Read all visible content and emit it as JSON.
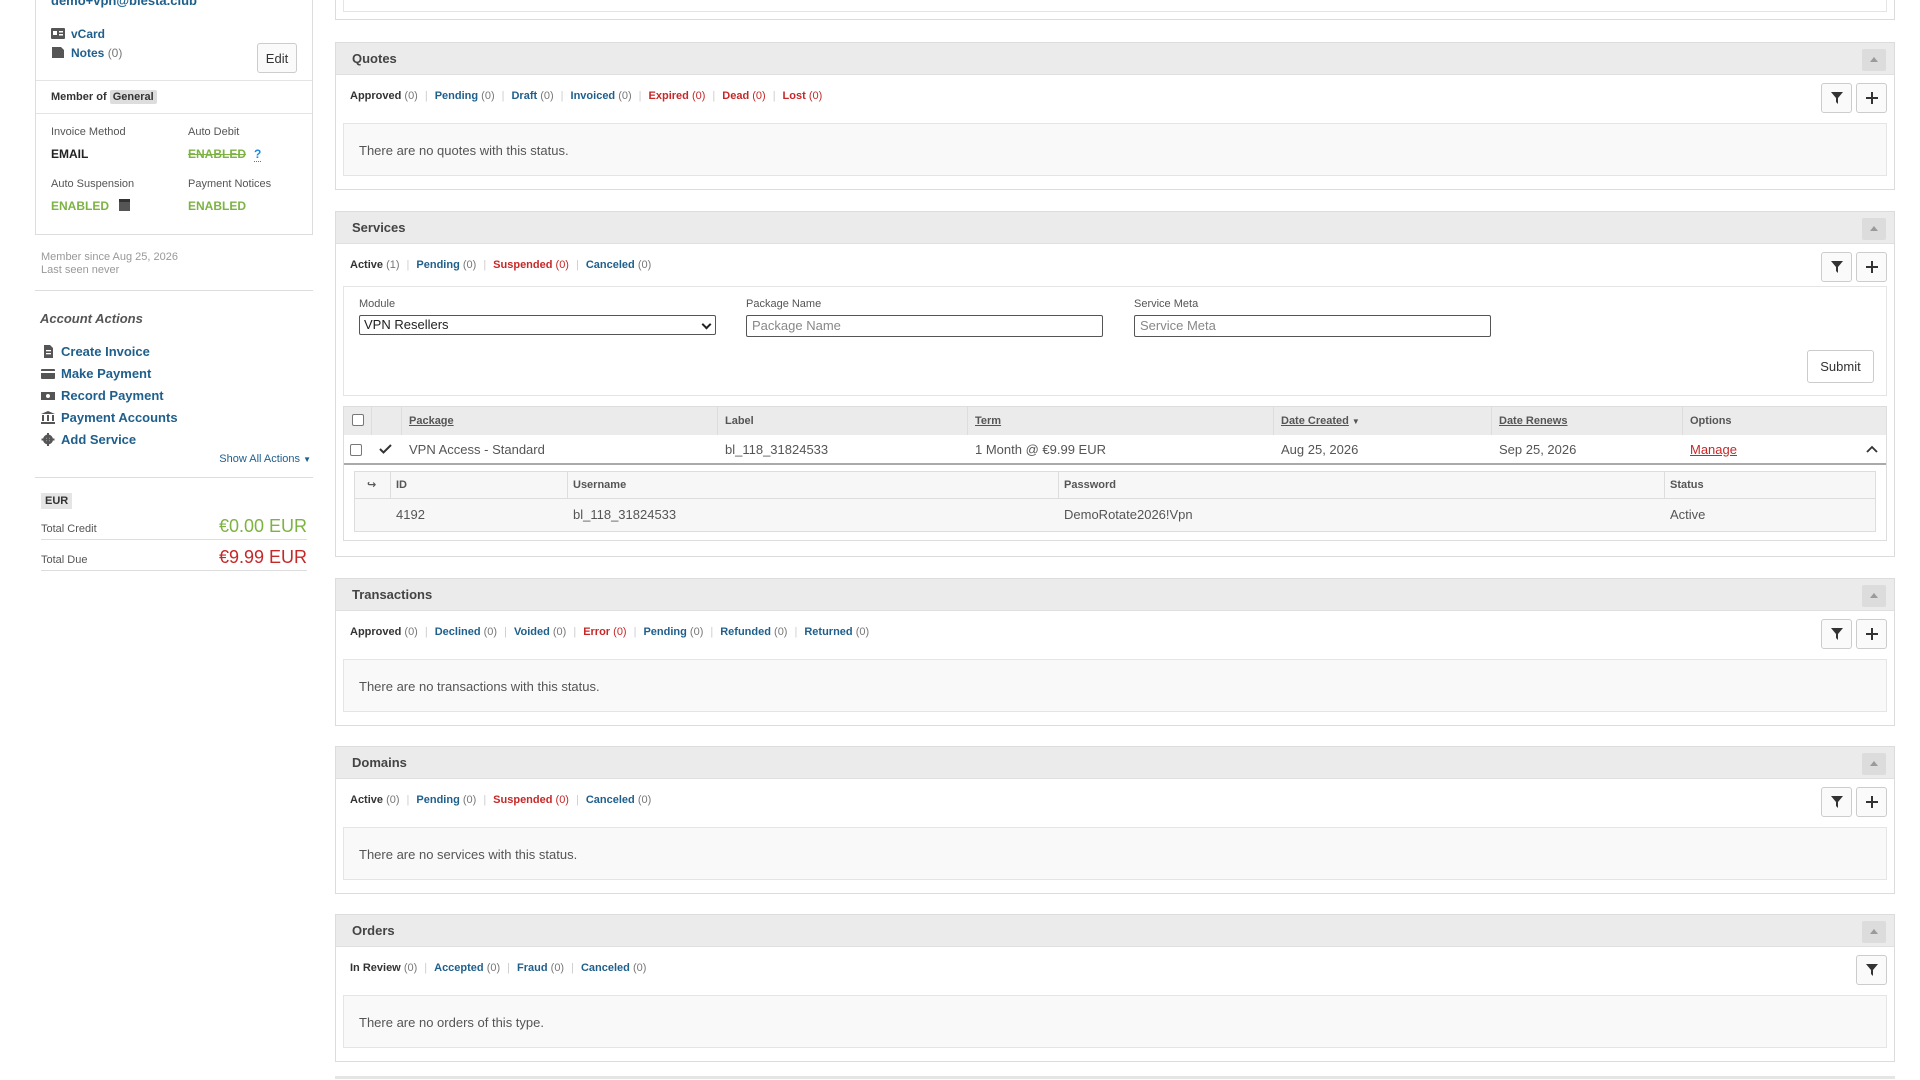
{
  "client": {
    "email": "demo+vpn@blesta.club",
    "vcard_label": "vCard",
    "notes_label": "Notes",
    "notes_count": "(0)",
    "edit_label": "Edit",
    "member_of_label": "Member of",
    "group": "General",
    "settings": {
      "invoice_method_label": "Invoice Method",
      "invoice_method": "EMAIL",
      "auto_debit_label": "Auto Debit",
      "auto_debit": "ENABLED",
      "auto_debit_help": "?",
      "auto_suspension_label": "Auto Suspension",
      "auto_suspension": "ENABLED",
      "payment_notices_label": "Payment Notices",
      "payment_notices": "ENABLED"
    },
    "member_since": "Member since Aug 25, 2026",
    "last_seen": "Last seen never"
  },
  "account_actions": {
    "heading": "Account Actions",
    "items": [
      {
        "label": "Create Invoice",
        "icon": "file-invoice-icon"
      },
      {
        "label": "Make Payment",
        "icon": "credit-card-icon"
      },
      {
        "label": "Record Payment",
        "icon": "money-icon"
      },
      {
        "label": "Payment Accounts",
        "icon": "bank-icon"
      },
      {
        "label": "Add Service",
        "icon": "gear-icon"
      }
    ],
    "show_all": "Show All Actions"
  },
  "balance": {
    "currency": "EUR",
    "total_credit_label": "Total Credit",
    "total_credit": "€0.00 EUR",
    "total_due_label": "Total Due",
    "total_due": "€9.99 EUR"
  },
  "quotes": {
    "title": "Quotes",
    "tabs": [
      {
        "label": "Approved",
        "count": "(0)",
        "style": "default"
      },
      {
        "label": "Pending",
        "count": "(0)",
        "style": "blue"
      },
      {
        "label": "Draft",
        "count": "(0)",
        "style": "blue"
      },
      {
        "label": "Invoiced",
        "count": "(0)",
        "style": "blue"
      },
      {
        "label": "Expired",
        "count": "(0)",
        "style": "red"
      },
      {
        "label": "Dead",
        "count": "(0)",
        "style": "red"
      },
      {
        "label": "Lost",
        "count": "(0)",
        "style": "red"
      }
    ],
    "empty": "There are no quotes with this status."
  },
  "services": {
    "title": "Services",
    "tabs": [
      {
        "label": "Active",
        "count": "(1)",
        "style": "default"
      },
      {
        "label": "Pending",
        "count": "(0)",
        "style": "blue"
      },
      {
        "label": "Suspended",
        "count": "(0)",
        "style": "red"
      },
      {
        "label": "Canceled",
        "count": "(0)",
        "style": "blue"
      }
    ],
    "filter": {
      "module_label": "Module",
      "module_value": "VPN Resellers",
      "package_label": "Package Name",
      "package_placeholder": "Package Name",
      "meta_label": "Service Meta",
      "meta_placeholder": "Service Meta",
      "submit": "Submit"
    },
    "columns": {
      "package": "Package",
      "label": "Label",
      "term": "Term",
      "date_created": "Date Created",
      "date_renews": "Date Renews",
      "options": "Options"
    },
    "row": {
      "package": "VPN Access - Standard",
      "label": "bl_118_31824533",
      "term": "1 Month @ €9.99 EUR",
      "date_created": "Aug 25, 2026",
      "date_renews": "Sep 25, 2026",
      "manage": "Manage"
    },
    "detail": {
      "columns": {
        "id": "ID",
        "username": "Username",
        "password": "Password",
        "status": "Status"
      },
      "row": {
        "id": "4192",
        "username": "bl_118_31824533",
        "password": "DemoRotate2026!Vpn",
        "status": "Active"
      }
    }
  },
  "transactions": {
    "title": "Transactions",
    "tabs": [
      {
        "label": "Approved",
        "count": "(0)",
        "style": "default"
      },
      {
        "label": "Declined",
        "count": "(0)",
        "style": "blue"
      },
      {
        "label": "Voided",
        "count": "(0)",
        "style": "blue"
      },
      {
        "label": "Error",
        "count": "(0)",
        "style": "red"
      },
      {
        "label": "Pending",
        "count": "(0)",
        "style": "blue"
      },
      {
        "label": "Refunded",
        "count": "(0)",
        "style": "blue"
      },
      {
        "label": "Returned",
        "count": "(0)",
        "style": "blue"
      }
    ],
    "empty": "There are no transactions with this status."
  },
  "domains": {
    "title": "Domains",
    "tabs": [
      {
        "label": "Active",
        "count": "(0)",
        "style": "default"
      },
      {
        "label": "Pending",
        "count": "(0)",
        "style": "blue"
      },
      {
        "label": "Suspended",
        "count": "(0)",
        "style": "red"
      },
      {
        "label": "Canceled",
        "count": "(0)",
        "style": "blue"
      }
    ],
    "empty": "There are no services with this status."
  },
  "orders": {
    "title": "Orders",
    "tabs": [
      {
        "label": "In Review",
        "count": "(0)",
        "style": "default"
      },
      {
        "label": "Accepted",
        "count": "(0)",
        "style": "blue"
      },
      {
        "label": "Fraud",
        "count": "(0)",
        "style": "blue"
      },
      {
        "label": "Canceled",
        "count": "(0)",
        "style": "blue"
      }
    ],
    "empty": "There are no orders of this type."
  },
  "colors": {
    "link": "#1e5f8c",
    "danger": "#c62828",
    "success": "#7cb342",
    "header_bg": "#ebebeb"
  }
}
